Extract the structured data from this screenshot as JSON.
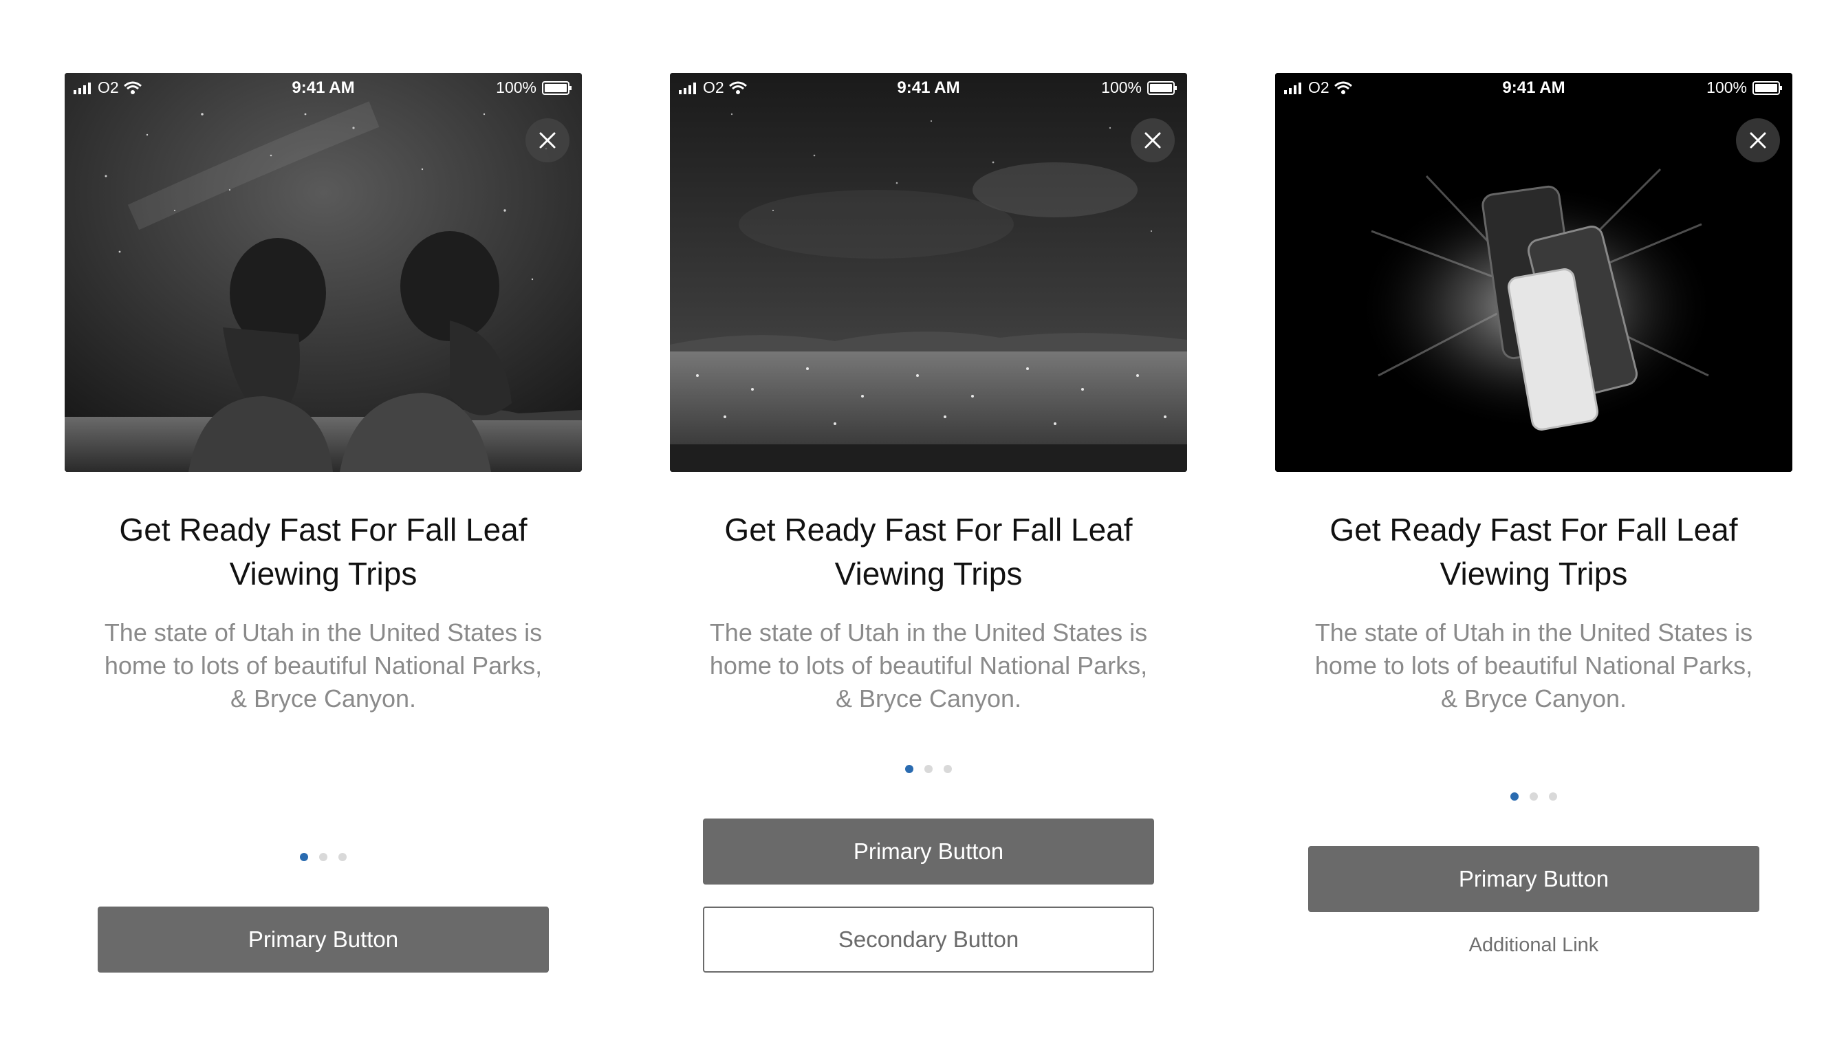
{
  "status_bar": {
    "carrier": "O2",
    "time": "9:41 AM",
    "battery": "100%"
  },
  "cards": [
    {
      "title": "Get Ready Fast For Fall Leaf\nViewing Trips",
      "body": "The state of Utah in the United States is home to lots of beautiful National Parks, & Bryce Canyon.",
      "image": "two-bearded-men-starry-sky-photo",
      "pagination": {
        "total": 3,
        "active": 1
      },
      "primary_label": "Primary Button"
    },
    {
      "title": "Get Ready Fast For Fall Leaf\nViewing Trips",
      "body": "The state of Utah in the United States is home to lots of beautiful National Parks, & Bryce Canyon.",
      "image": "city-lights-night-sky-photo",
      "pagination": {
        "total": 3,
        "active": 1
      },
      "primary_label": "Primary Button",
      "secondary_label": "Secondary Button"
    },
    {
      "title": "Get Ready Fast For Fall Leaf\nViewing Trips",
      "body": "The state of Utah in the United States is home to lots of beautiful National Parks, & Bryce Canyon.",
      "image": "smartphones-explosion-photo",
      "pagination": {
        "total": 3,
        "active": 1
      },
      "primary_label": "Primary Button",
      "link_label": "Additional Link"
    }
  ],
  "colors": {
    "primary_button": "#6a6a6a",
    "active_dot": "#2a6bb0",
    "inactive_dot": "#d9d9d9",
    "body_text": "#8a8a8a"
  }
}
